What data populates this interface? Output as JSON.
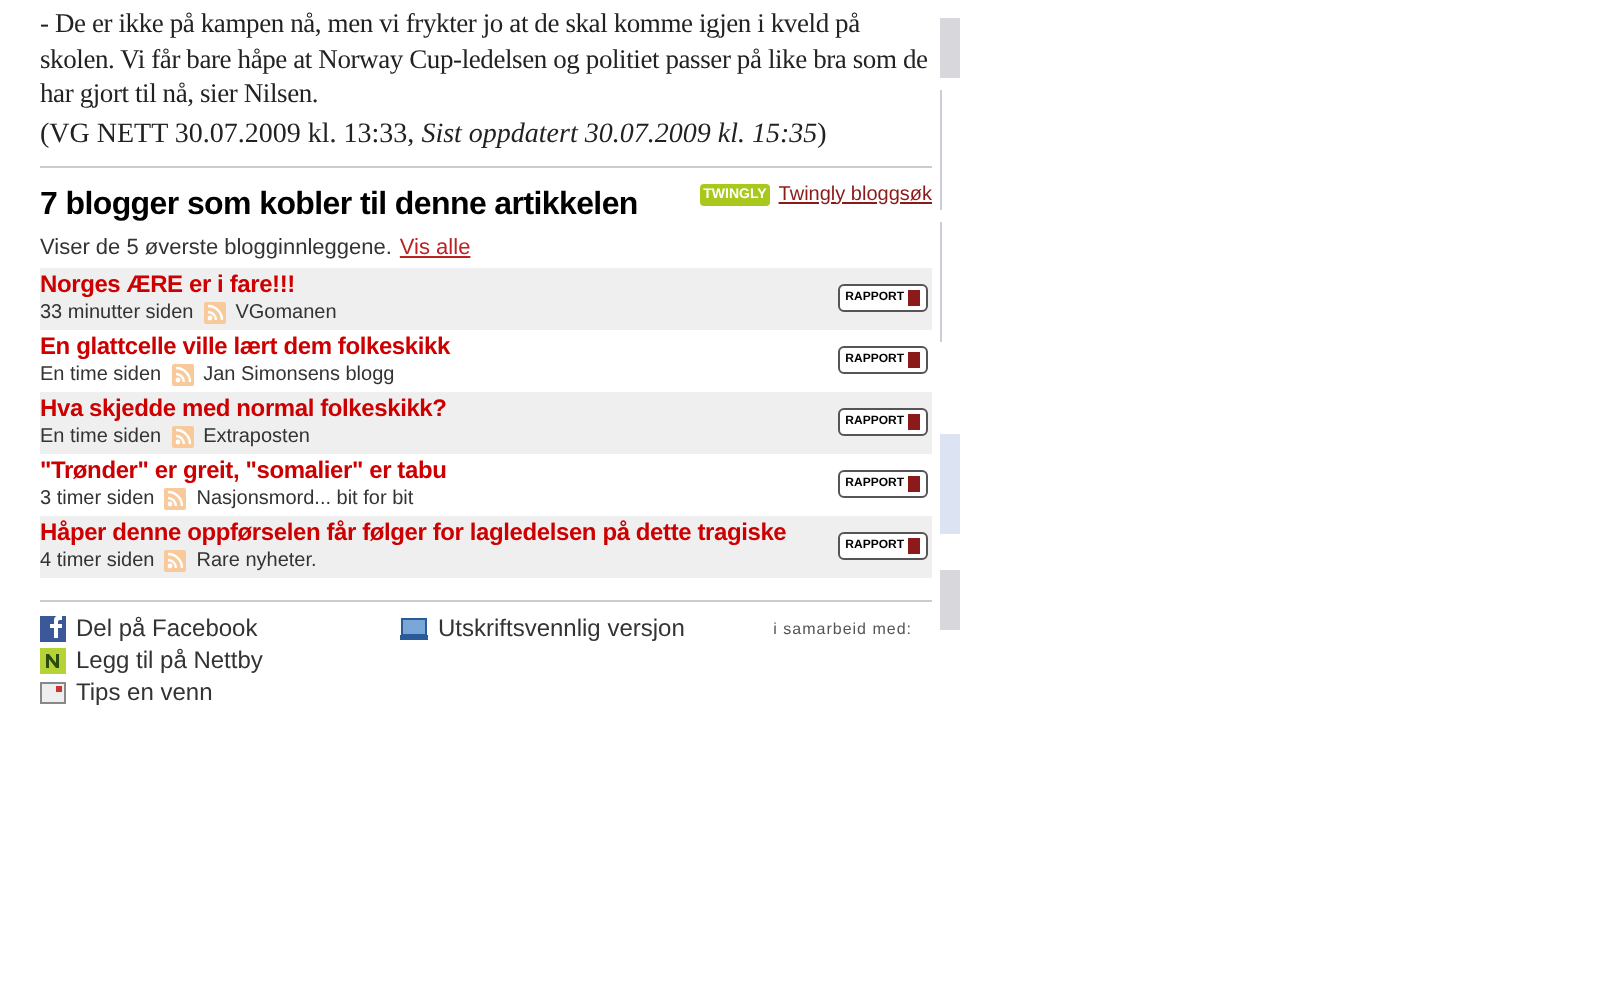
{
  "article": {
    "paragraph": "- De er ikke på kampen nå, men vi frykter jo at de skal komme igjen i kveld på skolen. Vi får bare håpe at Norway Cup-ledelsen og politiet passer på like bra som de har gjort til nå, sier Nilsen.",
    "source": "(VG NETT 30.07.2009 kl. 13:33, ",
    "updated": "Sist oppdatert 30.07.2009 kl. 15:35",
    "source_end": ")"
  },
  "blogs": {
    "heading": "7 blogger som kobler til denne artikkelen",
    "twingly_logo": "TWINGLY",
    "twingly_link": "Twingly bloggsøk",
    "showing": "Viser de 5 øverste blogginnleggene.",
    "show_all": "Vis alle",
    "posts": [
      {
        "title": "Norges ÆRE er i fare!!!",
        "time": "33 minutter siden",
        "blog": "VGomanen",
        "report": "RAPPORT"
      },
      {
        "title": "En glattcelle ville lært dem folkeskikk",
        "time": "En time siden",
        "blog": "Jan Simonsens blogg",
        "report": "RAPPORT"
      },
      {
        "title": "Hva skjedde med normal folkeskikk?",
        "time": "En time siden",
        "blog": "Extraposten",
        "report": "RAPPORT"
      },
      {
        "title": "\"Trønder\" er greit, \"somalier\" er tabu",
        "time": "3 timer siden",
        "blog": "Nasjonsmord... bit for bit",
        "report": "RAPPORT"
      },
      {
        "title": "Håper denne oppførselen får følger for lagledelsen på dette tragiske",
        "time": "4 timer siden",
        "blog": "Rare nyheter.",
        "report": "RAPPORT"
      }
    ]
  },
  "share": {
    "links": [
      {
        "kind": "facebook",
        "label": "Del på Facebook"
      },
      {
        "kind": "nettby",
        "label": "Legg til på Nettby"
      },
      {
        "kind": "mail",
        "label": "Tips en venn"
      }
    ],
    "print": "Utskriftsvennlig versjon",
    "partner": "i samarbeid med:"
  }
}
